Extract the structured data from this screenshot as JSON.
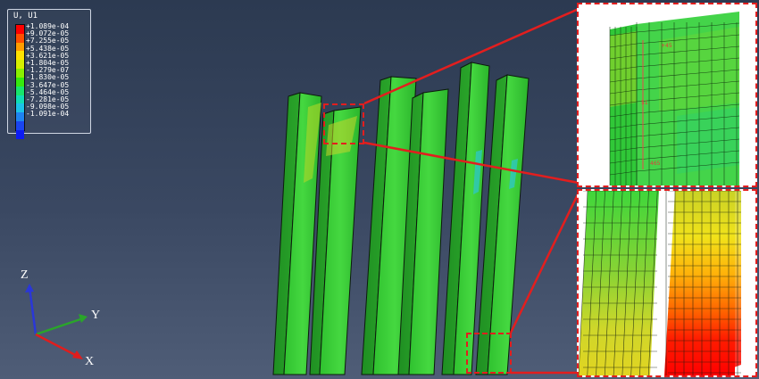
{
  "legend": {
    "title": "U, U1",
    "labels": [
      "+1.089e-04",
      "+9.072e-05",
      "+7.255e-05",
      "+5.438e-05",
      "+3.621e-05",
      "+1.804e-05",
      "-1.279e-07",
      "-1.830e-05",
      "-3.647e-05",
      "-5.464e-05",
      "-7.281e-05",
      "-9.098e-05",
      "-1.091e-04"
    ],
    "colors": [
      "#ff0000",
      "#ff4f00",
      "#ff9d00",
      "#ffe100",
      "#d6f000",
      "#8af000",
      "#36e80e",
      "#18e46b",
      "#11dcb5",
      "#1cc2e8",
      "#1f83f0",
      "#1a45f0",
      "#0d1cf2"
    ]
  },
  "axes": {
    "z": "Z",
    "y": "Y",
    "x": "X"
  },
  "zoom_top": {
    "marker_labels": [
      "+45",
      "51",
      "465"
    ]
  },
  "colors": {
    "callout": "#e31e1e",
    "model_green": "#39d13a",
    "background": "#33415a"
  }
}
